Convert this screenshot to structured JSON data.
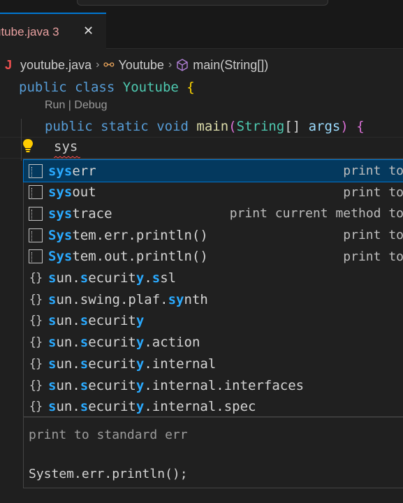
{
  "tab": {
    "label": "utube.java 3",
    "close": "✕"
  },
  "breadcrumb": {
    "file": "youtube.java",
    "class": "Youtube",
    "method": "main(String[])"
  },
  "code": {
    "line1": {
      "kw1": "public",
      "kw2": "class",
      "name": "Youtube",
      "brace": "{"
    },
    "codelens": "Run | Debug",
    "line2": {
      "kw1": "public",
      "kw2": "static",
      "kw3": "void",
      "fn": "main",
      "open": "(",
      "type": "String",
      "arr": "[]",
      "arg": "args",
      "close": ")",
      "brace": "{"
    },
    "typed": "sys"
  },
  "suggestions": [
    {
      "icon": "snippet-icon",
      "pre": "",
      "hl": "sys",
      "post": "err",
      "detail": "print to"
    },
    {
      "icon": "snippet-icon",
      "pre": "",
      "hl": "sys",
      "post": "out",
      "detail": "print to"
    },
    {
      "icon": "snippet-icon",
      "pre": "",
      "hl": "sys",
      "post": "trace",
      "detail": "print current method to"
    },
    {
      "icon": "snippet-icon",
      "pre": "",
      "hl": "Sys",
      "post": "tem.err.println()",
      "detail": "print to"
    },
    {
      "icon": "snippet-icon",
      "pre": "",
      "hl": "Sys",
      "post": "tem.out.println()",
      "detail": "print to"
    },
    {
      "icon": "module-icon",
      "pre": "",
      "hl": "s",
      "post": "un.",
      "hl2": "s",
      "post2": "ecurit",
      "hl3": "y",
      "post3": ".",
      "hl4": "s",
      "post4": "sl",
      "detail": ""
    },
    {
      "icon": "module-icon",
      "pre": "",
      "hl": "s",
      "post": "un.swing.plaf.",
      "hl2": "sy",
      "post2": "nth",
      "detail": ""
    },
    {
      "icon": "module-icon",
      "pre": "",
      "hl": "s",
      "post": "un.",
      "hl2": "s",
      "post2": "ecurit",
      "hl3": "y",
      "post3": "",
      "detail": ""
    },
    {
      "icon": "module-icon",
      "pre": "",
      "hl": "s",
      "post": "un.",
      "hl2": "s",
      "post2": "ecurit",
      "hl3": "y",
      "post3": ".action",
      "detail": ""
    },
    {
      "icon": "module-icon",
      "pre": "",
      "hl": "s",
      "post": "un.",
      "hl2": "s",
      "post2": "ecurit",
      "hl3": "y",
      "post3": ".internal",
      "detail": ""
    },
    {
      "icon": "module-icon",
      "pre": "",
      "hl": "s",
      "post": "un.",
      "hl2": "s",
      "post2": "ecurit",
      "hl3": "y",
      "post3": ".internal.interfaces",
      "detail": ""
    },
    {
      "icon": "module-icon",
      "pre": "",
      "hl": "s",
      "post": "un.",
      "hl2": "s",
      "post2": "ecurit",
      "hl3": "y",
      "post3": ".internal.spec",
      "detail": ""
    }
  ],
  "details": {
    "doc": "print to standard err",
    "snippet": "System.err.println();"
  },
  "colors": {
    "accent": "#0078d4",
    "highlight": "#2aaaff",
    "selection": "#04395e"
  }
}
